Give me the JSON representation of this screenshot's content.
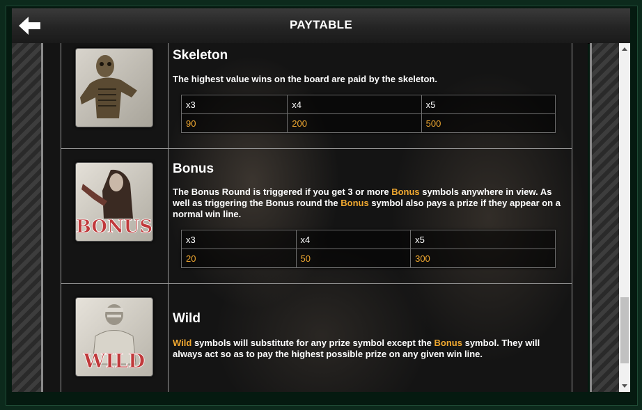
{
  "header": {
    "title": "PAYTABLE",
    "back_icon": "arrow-left-icon"
  },
  "symbols": [
    {
      "name": "Skeleton",
      "description": "The highest value wins on the board are paid by the skeleton.",
      "pays": {
        "headers": [
          "x3",
          "x4",
          "x5"
        ],
        "values": [
          "90",
          "200",
          "500"
        ]
      }
    },
    {
      "name": "Bonus",
      "description_parts": [
        "The Bonus Round is triggered if you get 3 or more ",
        "Bonus",
        " symbols anywhere in view. As well as triggering the Bonus round the ",
        "Bonus",
        " symbol also pays a prize if they appear on a normal win line."
      ],
      "image_text": "BONUS",
      "pays": {
        "headers": [
          "x3",
          "x4",
          "x5"
        ],
        "values": [
          "20",
          "50",
          "300"
        ]
      }
    },
    {
      "name": "Wild",
      "description_parts": [
        "Wild",
        " symbols will substitute for any prize symbol except the ",
        "Bonus",
        " symbol. They will always act so as to pay the highest possible prize on any given win line."
      ],
      "image_text": "WILD"
    }
  ],
  "colors": {
    "highlight": "#f0a830",
    "header_bg": "#2a2a2a"
  }
}
